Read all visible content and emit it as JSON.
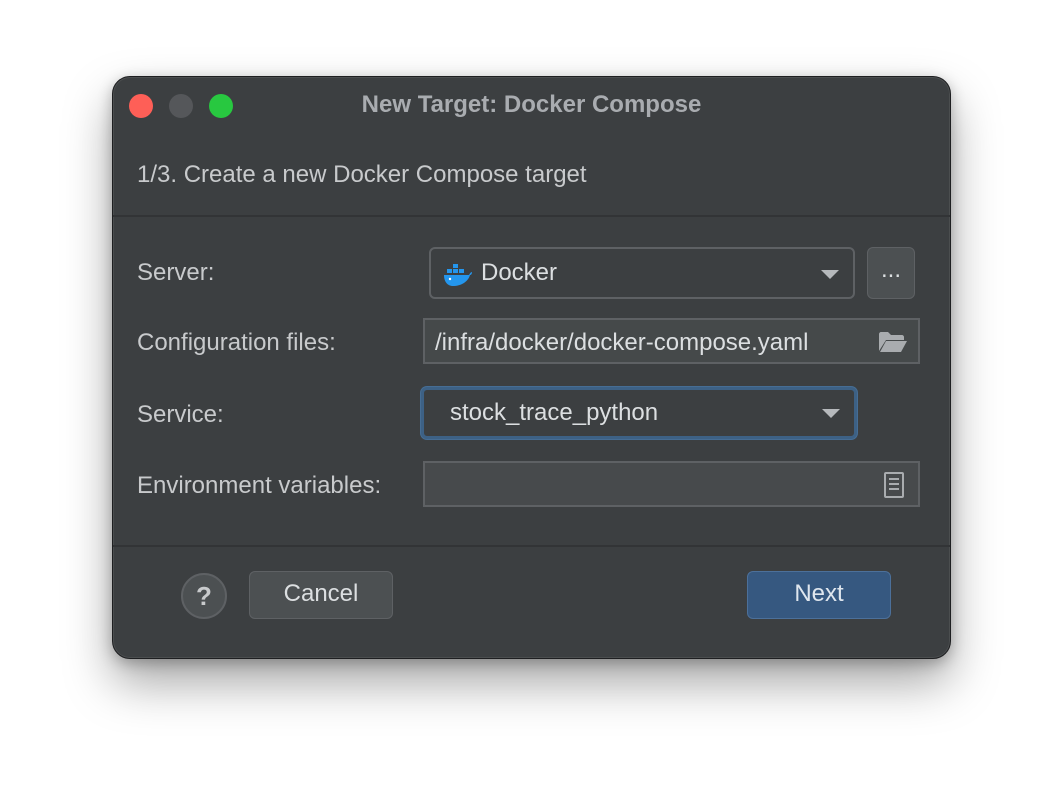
{
  "window": {
    "title": "New Target: Docker Compose",
    "step": "1/3. Create a new Docker Compose target"
  },
  "form": {
    "server": {
      "label": "Server:",
      "value": "Docker",
      "browse_label": "...",
      "icon": "docker-icon"
    },
    "config_files": {
      "label": "Configuration files:",
      "value": "/infra/docker/docker-compose.yaml",
      "icon": "folder-icon"
    },
    "service": {
      "label": "Service:",
      "value": "stock_trace_python"
    },
    "env_vars": {
      "label": "Environment variables:",
      "value": "",
      "icon": "document-icon"
    }
  },
  "footer": {
    "help_label": "?",
    "cancel_label": "Cancel",
    "next_label": "Next"
  },
  "colors": {
    "background": "#3c3f41",
    "accent": "#365880",
    "close": "#fe5f57",
    "minimize": "#55575a",
    "maximize": "#28c840",
    "docker_blue": "#2496ed"
  }
}
